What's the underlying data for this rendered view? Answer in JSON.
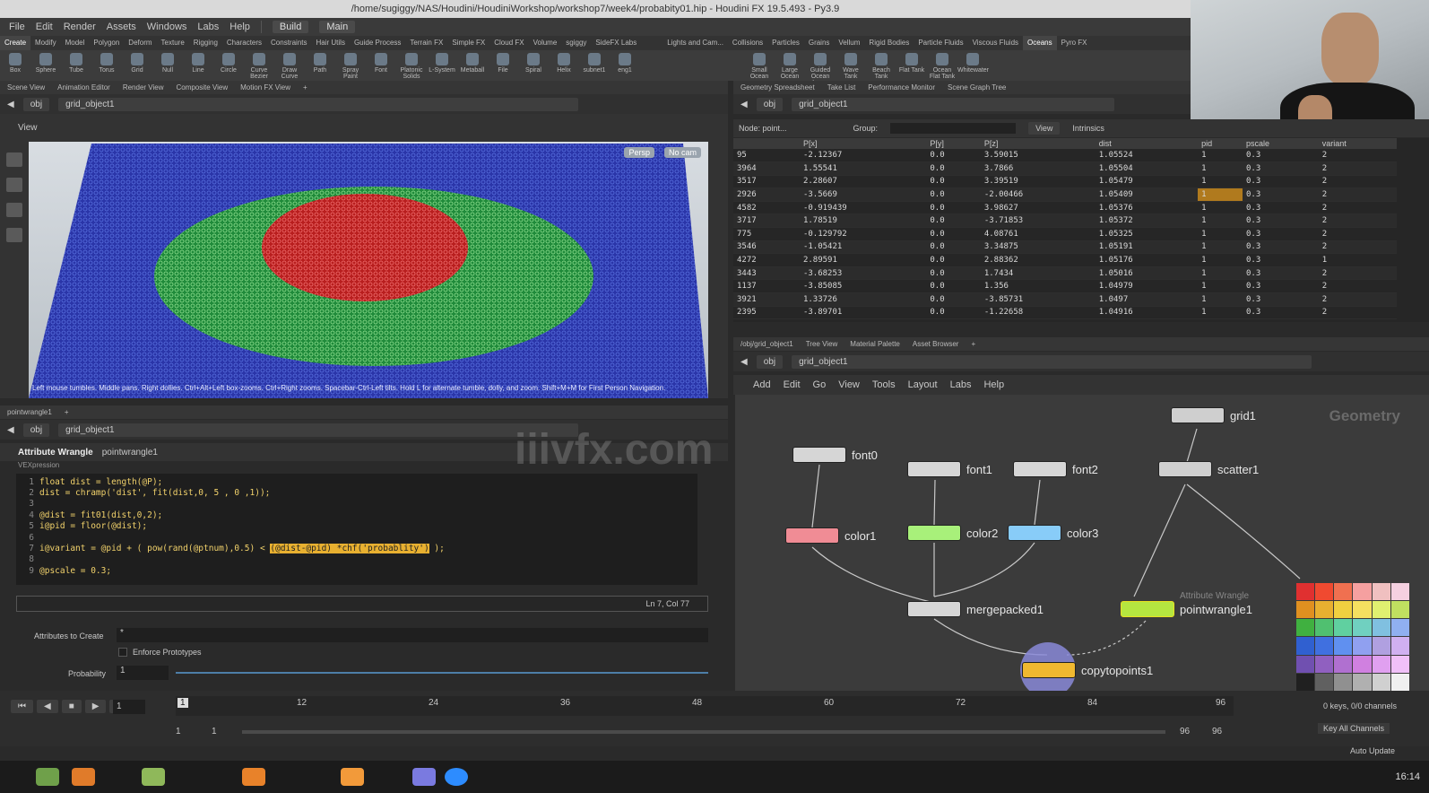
{
  "window": {
    "title": "/home/sugiggy/NAS/Houdini/HoudiniWorkshop/workshop7/week4/probabity01.hip - Houdini FX 19.5.493 - Py3.9"
  },
  "menu": [
    "File",
    "Edit",
    "Render",
    "Assets",
    "Windows",
    "Labs",
    "Help"
  ],
  "desktop": "Build",
  "context": "Main",
  "shelf_tabs": [
    "Create",
    "Modify",
    "Model",
    "Polygon",
    "Deform",
    "Texture",
    "Rigging",
    "Characters",
    "Constraints",
    "Hair Utils",
    "Guide Process",
    "Terrain FX",
    "Simple FX",
    "Cloud FX",
    "Volume",
    "sgiggy",
    "SideFX Labs"
  ],
  "shelf_tabs_right": [
    "Lights and Cam...",
    "Collisions",
    "Particles",
    "Grains",
    "Vellum",
    "Rigid Bodies",
    "Particle Fluids",
    "Viscous Fluids",
    "Oceans",
    "Pyro FX"
  ],
  "tools": [
    "Box",
    "Sphere",
    "Tube",
    "Torus",
    "Grid",
    "Null",
    "Line",
    "Circle",
    "Curve Bezier",
    "Draw Curve",
    "Path",
    "Spray Paint",
    "Font",
    "Platonic Solids",
    "L-System",
    "Metaball",
    "File",
    "Spiral",
    "Helix",
    "subnet1",
    "eng1"
  ],
  "tools_right": [
    "Small Ocean",
    "Large Ocean",
    "Guided Ocean Layer",
    "Wave Tank",
    "Beach Tank",
    "Flat Tank",
    "Ocean Flat Tank",
    "Whitewater"
  ],
  "left_tabs": [
    "Scene View",
    "Animation Editor",
    "Render View",
    "Composite View",
    "Motion FX View"
  ],
  "path": {
    "obj": "obj",
    "node": "grid_object1"
  },
  "viewport": {
    "label": "View",
    "persp": "Persp",
    "cam": "No cam",
    "hint": "Left mouse tumbles. Middle pans. Right dollies. Ctrl+Alt+Left box-zooms. Ctrl+Right zooms. Spacebar-Ctrl-Left tilts. Hold L for alternate tumble, dolly, and zoom.    Shift+M+M for First Person Navigation."
  },
  "right_tabs": [
    "Geometry Spreadsheet",
    "Take List",
    "Performance Monitor",
    "Scene Graph Tree"
  ],
  "spreadsheet": {
    "node": "Node: point...",
    "group": "Group:",
    "view": "View",
    "intrinsics": "Intrinsics",
    "headers": [
      "",
      "P[x]",
      "P[y]",
      "P[z]",
      "dist",
      "pid",
      "pscale",
      "variant"
    ],
    "rows": [
      [
        "95",
        "-2.12367",
        "0.0",
        "3.59015",
        "1.05524",
        "1",
        "0.3",
        "2"
      ],
      [
        "3964",
        "1.55541",
        "0.0",
        "3.7866",
        "1.05504",
        "1",
        "0.3",
        "2"
      ],
      [
        "3517",
        "2.28607",
        "0.0",
        "3.39519",
        "1.05479",
        "1",
        "0.3",
        "2"
      ],
      [
        "2926",
        "-3.5669",
        "0.0",
        "-2.00466",
        "1.05409",
        "1",
        "0.3",
        "2"
      ],
      [
        "4582",
        "-0.919439",
        "0.0",
        "3.98627",
        "1.05376",
        "1",
        "0.3",
        "2"
      ],
      [
        "3717",
        "1.78519",
        "0.0",
        "-3.71853",
        "1.05372",
        "1",
        "0.3",
        "2"
      ],
      [
        "775",
        "-0.129792",
        "0.0",
        "4.08761",
        "1.05325",
        "1",
        "0.3",
        "2"
      ],
      [
        "3546",
        "-1.05421",
        "0.0",
        "3.34875",
        "1.05191",
        "1",
        "0.3",
        "2"
      ],
      [
        "4272",
        "2.89591",
        "0.0",
        "2.88362",
        "1.05176",
        "1",
        "0.3",
        "1"
      ],
      [
        "3443",
        "-3.68253",
        "0.0",
        "1.7434",
        "1.05016",
        "1",
        "0.3",
        "2"
      ],
      [
        "1137",
        "-3.85085",
        "0.0",
        "1.356",
        "1.04979",
        "1",
        "0.3",
        "2"
      ],
      [
        "3921",
        "1.33726",
        "0.0",
        "-3.85731",
        "1.0497",
        "1",
        "0.3",
        "2"
      ],
      [
        "2395",
        "-3.89701",
        "0.0",
        "-1.22658",
        "1.04916",
        "1",
        "0.3",
        "2"
      ]
    ]
  },
  "params_pane": {
    "tab": "pointwrangle1",
    "type": "Attribute Wrangle",
    "name": "pointwrangle1",
    "vex_label": "VEXpression",
    "code": [
      "float dist = length(@P);",
      "dist = chramp('dist', fit(dist,0, 5 , 0 ,1));",
      "",
      "@dist = fit01(dist,0,2);",
      "i@pid = floor(@dist);",
      "",
      "i@variant = @pid + ( pow(rand(@ptnum),0.5) < (@dist-@pid) *chf('probablity') );",
      "",
      "@pscale = 0.3;"
    ],
    "code_pre": "i@variant = @pid + ( pow(rand(@ptnum),0.5) < ",
    "code_hl": "(@dist-@pid) *chf('probablity')",
    "code_post": " );",
    "cursor": "Ln 7, Col 77",
    "attr_create_label": "Attributes to Create",
    "attr_create_value": "*",
    "enforce": "Enforce Prototypes",
    "prob_label": "Probability",
    "prob_value": "1"
  },
  "network": {
    "tabs": [
      "/obj/grid_object1",
      "Tree View",
      "Material Palette",
      "Asset Browser"
    ],
    "menu": [
      "Add",
      "Edit",
      "Go",
      "View",
      "Tools",
      "Layout",
      "Labs",
      "Help"
    ],
    "context": "Geometry",
    "nodes": {
      "grid1": "grid1",
      "scatter1": "scatter1",
      "font0": "font0",
      "font1": "font1",
      "font2": "font2",
      "color1": "color1",
      "color2": "color2",
      "color3": "color3",
      "merge": "mergepacked1",
      "wrangle_type": "Attribute Wrangle",
      "wrangle": "pointwrangle1",
      "copy": "copytopoints1"
    }
  },
  "timeline": {
    "frame": "1",
    "ticks": [
      "1",
      "12",
      "24",
      "36",
      "48",
      "60",
      "72",
      "84",
      "96"
    ],
    "start": "1",
    "start2": "1",
    "end": "96",
    "end2": "96",
    "keys": "0 keys, 0/0 channels",
    "keyall": "Key All Channels",
    "auto": "Auto Update"
  },
  "watermark": "iiivfx.com",
  "clock": "16:14"
}
